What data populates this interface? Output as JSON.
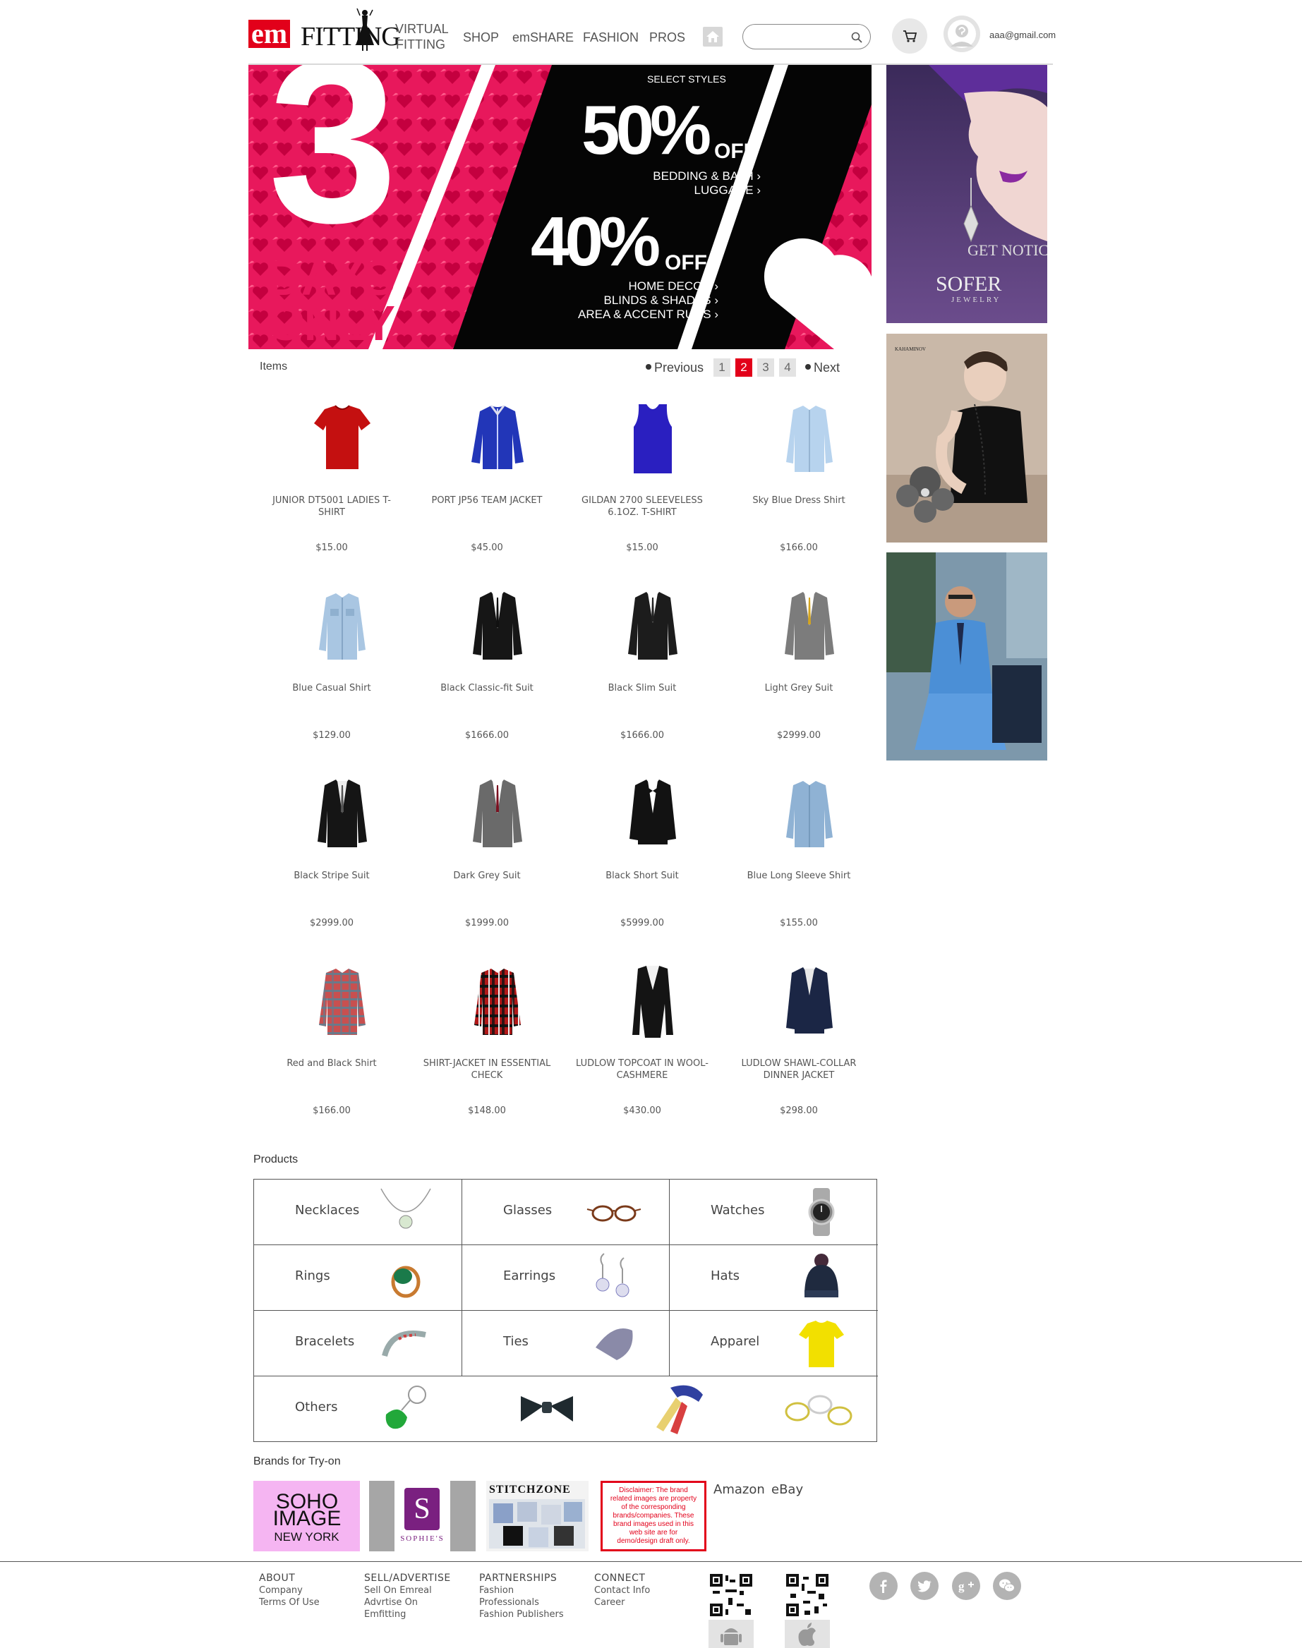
{
  "header": {
    "logo": {
      "em": "em",
      "fitting": "FITTING"
    },
    "nav": {
      "virtual_fitting": "VIRTUAL FITTING",
      "shop": "SHOP",
      "emshare": "emSHARE",
      "fashion": "FASHION",
      "pros": "PROS"
    },
    "search": {
      "value": "",
      "placeholder": ""
    },
    "user_email": "aaa@gmail.com"
  },
  "banner": {
    "select_styles": "SELECT STYLES",
    "pct1": "50%",
    "off1": "OFF",
    "line1a": "BEDDING & BATH ›",
    "line1b": "LUGGAGE ›",
    "pct2": "40%",
    "off2": "OFF",
    "line2a": "HOME DECOR ›",
    "line2b": "BLINDS & SHADES ›",
    "line2c": "AREA & ACCENT RUGS ›",
    "big_number": "3",
    "days": "DAYS",
    "only": "ONLY"
  },
  "side_ads": {
    "sofer": {
      "tagline": "GET NOTICED",
      "brand": "SOFER",
      "sub": "JEWELRY"
    },
    "kahaminov": {
      "brand": "KAHAMINOV"
    }
  },
  "items": {
    "label": "Items",
    "pager": {
      "previous": "Previous",
      "next": "Next",
      "pages": [
        "1",
        "2",
        "3",
        "4"
      ],
      "active_page": "2"
    },
    "list": [
      {
        "name": "JUNIOR DT5001 LADIES T-SHIRT",
        "price": "$15.00",
        "icon": "red-tshirt"
      },
      {
        "name": "PORT JP56 TEAM JACKET",
        "price": "$45.00",
        "icon": "blue-jacket"
      },
      {
        "name": "GILDAN 2700 SLEEVELESS 6.1OZ. T-SHIRT",
        "price": "$15.00",
        "icon": "blue-tank-top"
      },
      {
        "name": "Sky Blue Dress Shirt",
        "price": "$166.00",
        "icon": "dress-shirt"
      },
      {
        "name": "Blue Casual Shirt",
        "price": "$129.00",
        "icon": "casual-shirt"
      },
      {
        "name": "Black Classic-fit Suit",
        "price": "$1666.00",
        "icon": "black-suit"
      },
      {
        "name": "Black Slim Suit",
        "price": "$1666.00",
        "icon": "black-suit"
      },
      {
        "name": "Light Grey Suit",
        "price": "$2999.00",
        "icon": "grey-suit"
      },
      {
        "name": "Black Stripe Suit",
        "price": "$2999.00",
        "icon": "black-suit"
      },
      {
        "name": "Dark Grey Suit",
        "price": "$1999.00",
        "icon": "grey-suit"
      },
      {
        "name": "Black Short Suit",
        "price": "$5999.00",
        "icon": "tuxedo"
      },
      {
        "name": "Blue Long Sleeve Shirt",
        "price": "$155.00",
        "icon": "dress-shirt"
      },
      {
        "name": "Red and Black Shirt",
        "price": "$166.00",
        "icon": "plaid-shirt"
      },
      {
        "name": "SHIRT-JACKET IN ESSENTIAL CHECK",
        "price": "$148.00",
        "icon": "plaid-shirt"
      },
      {
        "name": "LUDLOW TOPCOAT IN WOOL-CASHMERE",
        "price": "$430.00",
        "icon": "black-coat"
      },
      {
        "name": "LUDLOW SHAWL-COLLAR DINNER JACKET",
        "price": "$298.00",
        "icon": "navy-jacket"
      }
    ]
  },
  "products": {
    "label": "Products",
    "categories": [
      {
        "label": "Necklaces",
        "icon": "necklace-icon"
      },
      {
        "label": "Glasses",
        "icon": "glasses-icon"
      },
      {
        "label": "Watches",
        "icon": "watch-icon"
      },
      {
        "label": "Rings",
        "icon": "ring-icon"
      },
      {
        "label": "Earrings",
        "icon": "earrings-icon"
      },
      {
        "label": "Hats",
        "icon": "hat-icon"
      },
      {
        "label": "Bracelets",
        "icon": "bracelet-icon"
      },
      {
        "label": "Ties",
        "icon": "tie-icon"
      },
      {
        "label": "Apparel",
        "icon": "tshirt-icon"
      },
      {
        "label": "Others",
        "icon": "keychain-icon"
      }
    ]
  },
  "brands": {
    "label": "Brands for Try-on",
    "soho": {
      "line1": "SOHO",
      "line2": "IMAGE",
      "line3": "NEW YORK"
    },
    "sophie": {
      "letter": "S",
      "name": "SOPHIE'S"
    },
    "stitchzone": {
      "name": "STITCHZONE"
    },
    "disclaimer": "Disclaimer: The brand related images are property of the corresponding brands/companies. These brand images used in this web site are for demo/design draft only.",
    "amazon": "Amazon",
    "ebay": "eBay"
  },
  "footer": {
    "about": {
      "heading": "ABOUT",
      "links": [
        "Company",
        "Terms Of Use"
      ]
    },
    "sell": {
      "heading": "SELL/ADVERTISE",
      "links": [
        "Sell On Emreal",
        "Advrtise On",
        "Emfitting"
      ]
    },
    "partnerships": {
      "heading": "PARTNERSHIPS",
      "links": [
        "Fashion",
        "Professionals",
        "Fashion Publishers"
      ]
    },
    "connect": {
      "heading": "CONNECT",
      "links": [
        "Contact Info",
        "Career"
      ]
    }
  },
  "colors": {
    "brand_red": "#e2001a",
    "banner_pink": "#e8185c"
  }
}
